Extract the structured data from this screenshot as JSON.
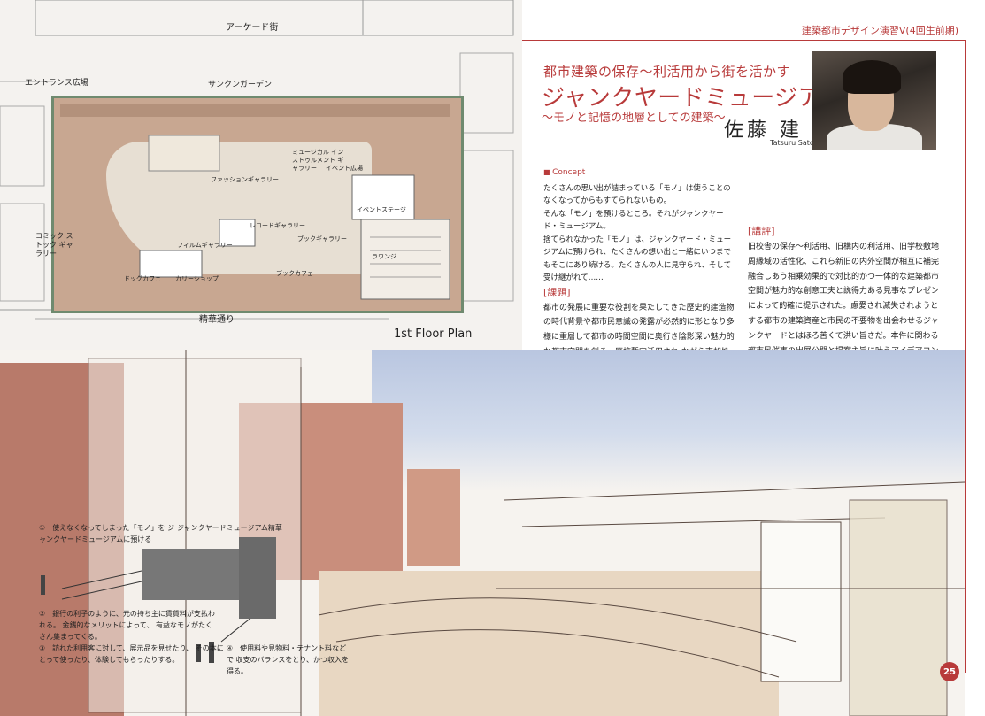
{
  "header": {
    "course": "建築都市デザイン演習Ⅴ(4回生前期)"
  },
  "title": {
    "kicker": "都市建築の保存～利活用から街を活かす",
    "main": "ジャンクヤードミュージアム精華",
    "sub": "～モノと記憶の地層としての建築～",
    "author_ja": "佐藤 建",
    "author_en": "Tatsuru Sato"
  },
  "concept": {
    "heading": "Concept",
    "paragraphs": [
      "たくさんの思い出が詰まっている「モノ」は使うことのなくなってからもすてられないもの。",
      "そんな「モノ」を預けるところ。それがジャンクヤード・ミュージアム。",
      "捨てられなかった「モノ」は、ジャンクヤード・ミュージアムに預けられ、たくさんの想い出と一緒にいつまでもそこにあり続ける。たくさんの人に見守られ、そして受け継がれて……"
    ]
  },
  "kadai": {
    "heading": "[課題]",
    "text": "都市の発展に重要な役割を果たしてきた歴史的建造物の時代背景や都市民意識の発露が必然的に形となり多様に重層して都市の時間空間に奥行き陰影深い魅力的な都市空間を創る。廃校暫定活用され ながら売却処分される旧大阪市立精華小学校幼稚園の敷地及びその周縁地域を計画対象に、優れた建築価値を尊重して新たな用途空間を付加設定しそれらの複合相乗効果により周縁商店街の活性化と共に持続可能型リセットを仮想して対社会に提示したい。"
  },
  "kohyo": {
    "heading": "[講評]",
    "text": "旧校舎の保存～利活用、旧構内の利活用、旧学校敷地周縁域の活性化、これら新旧の内外空間が相互に補完融合しあう相乗効果的で対比的かつ一体的な建築都市空間が魅力的な創意工夫と説得力ある見事なプレゼンによって的確に提示された。慮愛され滅失されようとする都市の建築資産と市民の不要物を出会わせるジャンクヤードとはほろ苦くて洪い旨さだ。本件に関わる都市民催事の出展公開と提案主旨に叶うアイデアコンペ公募入選で実社会にも提案できた。(担当教員：橋本 健治・福原 和則)"
  },
  "plan": {
    "caption": "1st Floor Plan",
    "arcade": "アーケード街",
    "entrance": "エントランス広場",
    "sunken": "サンクンガーデン",
    "street": "精華通り",
    "rooms": [
      "コミック ストック ギャラリー",
      "フィルムギャラリー",
      "レコードギャラリー",
      "ブックギャラリー",
      "イベント広場",
      "イベントステージ",
      "カリーショップ",
      "ブックカフェ",
      "ドッグカフェ",
      "ミュージカル インストゥルメント ギャラリー",
      "ファッションギャラリー",
      "ラウンジ"
    ]
  },
  "diagram": {
    "label_top": "ジャンクヤードミュージアム精華",
    "note1": "①　使えなくなってしまった「モノ」を ジャンクヤードミュージアムに預ける",
    "note2": "②　銀行の利子のように、元の持ち主に賃貸料が支払われる。 金銭的なメリットによって、 有益なモノがたくさん集まってくる。",
    "note3": "③　訪れた利用客に対して、展示品を見せたり、 その本にとって使ったり、体験してもらったりする。",
    "note4": "④　使用料や見物料・テナント料などで 収支のバランスをとり、かつ収入を得る。"
  },
  "page_number": "25"
}
